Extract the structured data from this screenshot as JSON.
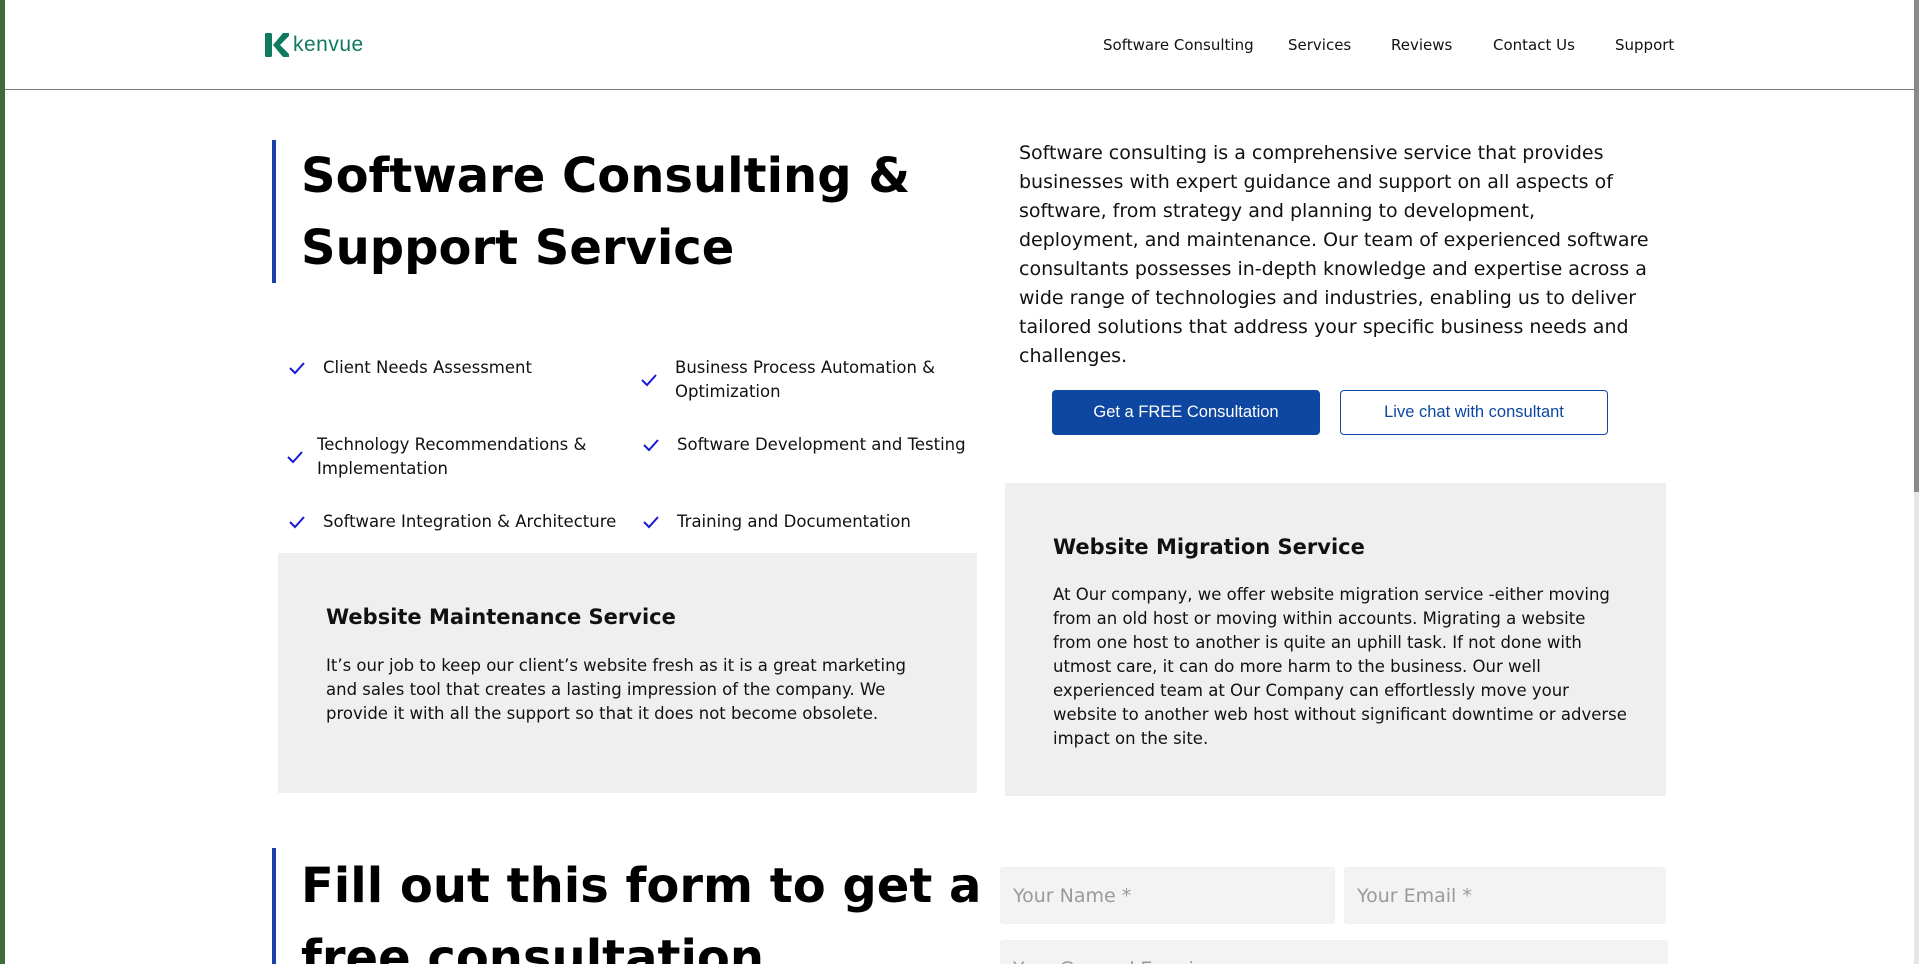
{
  "header": {
    "logo_text": "kenvue",
    "nav": [
      {
        "label": "Software Consulting"
      },
      {
        "label": "Services"
      },
      {
        "label": "Reviews"
      },
      {
        "label": "Contact Us"
      },
      {
        "label": "Support"
      }
    ]
  },
  "hero": {
    "title_line1": "Software Consulting &",
    "title_line2": "Support Service",
    "intro": "Software consulting is a comprehensive service that provides businesses with expert guidance and support on all aspects of software, from strategy and planning to development, deployment, and maintenance. Our team of experienced software consultants possesses in-depth knowledge and expertise across a wide range of technologies and industries, enabling us to deliver tailored solutions that address your specific business needs and challenges.",
    "features": [
      {
        "label": "Client Needs Assessment"
      },
      {
        "label": "Business Process Automation & Optimization"
      },
      {
        "label": "Technology Recommendations & Implementation"
      },
      {
        "label": "Software Development and Testing"
      },
      {
        "label": "Software Integration & Architecture"
      },
      {
        "label": "Training and Documentation"
      }
    ],
    "primary_button": "Get a FREE Consultation",
    "secondary_button": "Live chat with consultant"
  },
  "cards": {
    "maintenance": {
      "title": "Website Maintenance Service",
      "body": "It’s our job to keep our client’s website fresh as it is a great marketing and sales tool that creates a lasting impression of the company. We provide it with all the support so that it does not become obsolete."
    },
    "migration": {
      "title": "Website Migration Service",
      "body": "At Our company, we offer website migration service -either moving from an old host or moving within accounts. Migrating a website from one host to another is quite an uphill task. If not done with utmost care, it can do more harm to the business. Our well experienced team at Our Company can effortlessly move your website to another web host without significant downtime or adverse impact on the site."
    }
  },
  "form": {
    "title_line1": "Fill out this form to get a",
    "title_line2": "free consultation",
    "name_placeholder": "Your Name *",
    "email_placeholder": "Your Email *",
    "enquiry_placeholder": "Your General Enquiry"
  },
  "colors": {
    "accent": "#0d47a1",
    "brand": "#0e7a5f",
    "check": "#1a1ad6",
    "card_bg": "#efefef"
  }
}
